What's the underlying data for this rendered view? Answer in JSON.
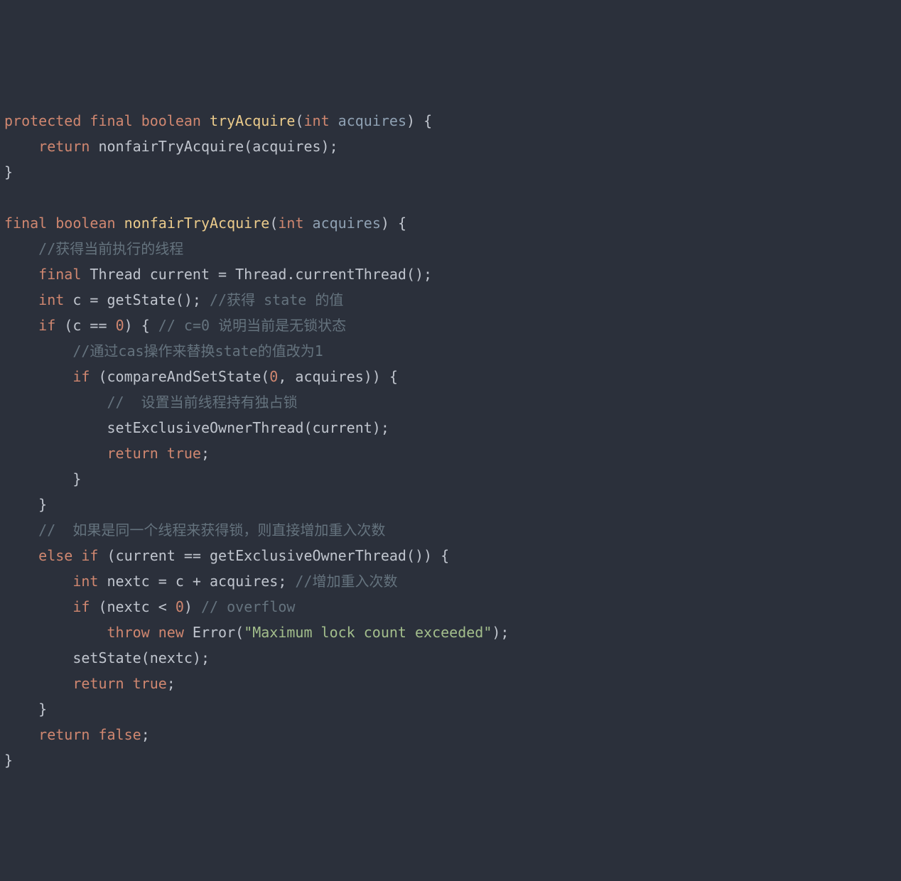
{
  "t": {
    "l1_protected": "protected",
    "l1_final": "final",
    "l1_boolean": "boolean",
    "l1_fn": "tryAcquire",
    "l1_open": "(",
    "l1_int": "int",
    "l1_param": "acquires",
    "l1_close": ") {",
    "l2_indent": "    ",
    "l2_return": "return",
    "l2_call": " nonfairTryAcquire(acquires);",
    "l3": "}",
    "l4": "",
    "l5_final": "final",
    "l5_boolean": "boolean",
    "l5_fn": "nonfairTryAcquire",
    "l5_open": "(",
    "l5_int": "int",
    "l5_param": "acquires",
    "l5_close": ") {",
    "l6_indent": "    ",
    "l6_cmt": "//获得当前执行的线程",
    "l7_indent": "    ",
    "l7_final": "final",
    "l7_rest": " Thread current = Thread.currentThread();",
    "l8_indent": "    ",
    "l8_int": "int",
    "l8_mid": " c = getState(); ",
    "l8_cmt": "//获得 state 的值",
    "l9_indent": "    ",
    "l9_if": "if",
    "l9_a": " (c == ",
    "l9_zero": "0",
    "l9_b": ") { ",
    "l9_cmt": "// c=0 说明当前是无锁状态",
    "l10_indent": "        ",
    "l10_cmt": "//通过cas操作来替换state的值改为1",
    "l11_indent": "        ",
    "l11_if": "if",
    "l11_a": " (compareAndSetState(",
    "l11_zero": "0",
    "l11_b": ", acquires)) {",
    "l12_indent": "            ",
    "l12_cmt": "//  设置当前线程持有独占锁",
    "l13_indent": "            ",
    "l13_call": "setExclusiveOwnerThread(current);",
    "l14_indent": "            ",
    "l14_return": "return",
    "l14_sp": " ",
    "l14_true": "true",
    "l14_semi": ";",
    "l15_indent": "        ",
    "l15_brace": "}",
    "l16_indent": "    ",
    "l16_brace": "}",
    "l17_indent": "    ",
    "l17_cmt": "//  如果是同一个线程来获得锁，则直接增加重入次数",
    "l18_indent": "    ",
    "l18_else": "else",
    "l18_sp": " ",
    "l18_if": "if",
    "l18_rest": " (current == getExclusiveOwnerThread()) {",
    "l19_indent": "        ",
    "l19_int": "int",
    "l19_mid": " nextc = c + acquires; ",
    "l19_cmt": "//增加重入次数",
    "l20_indent": "        ",
    "l20_if": "if",
    "l20_a": " (nextc < ",
    "l20_zero": "0",
    "l20_b": ") ",
    "l20_cmt": "// overflow",
    "l21_indent": "            ",
    "l21_throw": "throw",
    "l21_sp": " ",
    "l21_new": "new",
    "l21_err": " Error(",
    "l21_str": "\"Maximum lock count exceeded\"",
    "l21_close": ");",
    "l22_indent": "        ",
    "l22_call": "setState(nextc);",
    "l23_indent": "        ",
    "l23_return": "return",
    "l23_sp": " ",
    "l23_true": "true",
    "l23_semi": ";",
    "l24_indent": "    ",
    "l24_brace": "}",
    "l25_indent": "    ",
    "l25_return": "return",
    "l25_sp": " ",
    "l25_false": "false",
    "l25_semi": ";",
    "l26": "}"
  }
}
